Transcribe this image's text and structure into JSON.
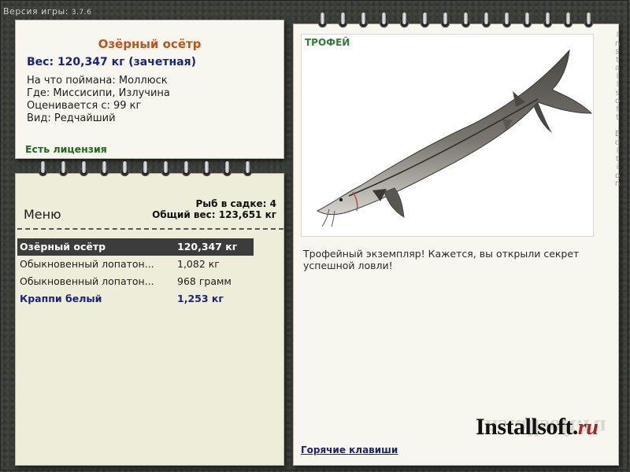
{
  "version": {
    "label": "Версия игры:",
    "number": "3.7.6"
  },
  "info": {
    "fish_name": "Озёрный осётр",
    "weight": "Вес: 120,347 кг (зачетная)",
    "bait": "На что поймана: Моллюск",
    "place": "Где: Миссисипи, Излучина",
    "rated": "Оценивается с: 99 кг",
    "kind": "Вид: Редчайший",
    "license": "Есть лицензия"
  },
  "menu": {
    "title": "Меню",
    "keep_count": "Рыб в садке: 4",
    "keep_weight": "Общий вес: 123,651 кг",
    "rows": [
      {
        "name": "Озёрный осётр",
        "weight": "120,347 кг"
      },
      {
        "name": "Обыкновенный лопатон...",
        "weight": "1,082 кг"
      },
      {
        "name": "Обыкновенный лопатон...",
        "weight": "968 грамм"
      },
      {
        "name": "Краппи белый",
        "weight": "1,253 кг"
      }
    ]
  },
  "trophy": {
    "label": "ТРОФЕЙ",
    "description": "Трофейный экземпляр! Кажется, вы открыли секрет успешной ловли!",
    "hotkeys": "Горячие клавиши"
  },
  "branding": {
    "logo_main": "Installsoft.",
    "logo_ru": "ru",
    "edition": "Installsoft Edition"
  },
  "colors": {
    "accent_orange": "#c0521a",
    "accent_blue": "#1a237e",
    "accent_green": "#2e7d32"
  }
}
